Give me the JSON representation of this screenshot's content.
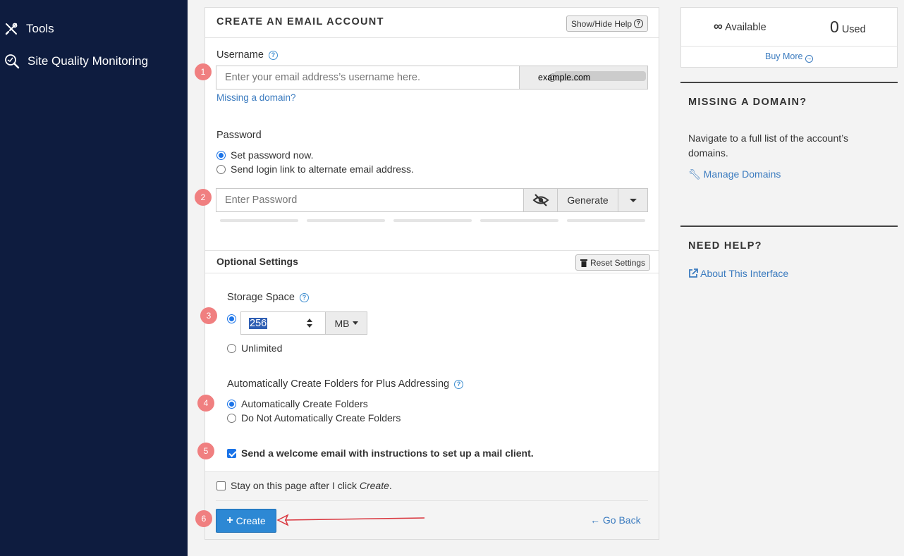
{
  "sidebar": {
    "items": [
      {
        "label": "Tools",
        "icon": "tools-icon"
      },
      {
        "label": "Site Quality Monitoring",
        "icon": "magnifier-icon"
      }
    ]
  },
  "main": {
    "title": "CREATE AN EMAIL ACCOUNT",
    "help_toggle": "Show/Hide Help",
    "username": {
      "label": "Username",
      "placeholder": "Enter your email address’s username here.",
      "at": "@",
      "domain": "example.com",
      "missing_link": "Missing a domain?"
    },
    "password": {
      "label": "Password",
      "options": [
        "Set password now.",
        "Send login link to alternate email address."
      ],
      "selected": 0,
      "placeholder": "Enter Password",
      "generate": "Generate"
    },
    "optional": {
      "title": "Optional Settings",
      "reset": "Reset Settings",
      "storage": {
        "label": "Storage Space",
        "value": "256",
        "unit": "MB",
        "unlimited": "Unlimited"
      },
      "plus": {
        "label": "Automatically Create Folders for Plus Addressing",
        "options": [
          "Automatically Create Folders",
          "Do Not Automatically Create Folders"
        ],
        "selected": 0
      },
      "welcome": "Send a welcome email with instructions to set up a mail client."
    },
    "footer": {
      "stay_prefix": "Stay on this page after I click ",
      "stay_em": "Create",
      "stay_suffix": ".",
      "create": "Create",
      "go_back": "Go Back"
    },
    "steps": [
      "1",
      "2",
      "3",
      "4",
      "5",
      "6"
    ]
  },
  "right": {
    "available_symbol": "∞",
    "available_label": "Available",
    "used_count": "0",
    "used_label": "Used",
    "buy_more": "Buy More",
    "missing_title": "MISSING A DOMAIN?",
    "missing_text": "Navigate to a full list of the account’s domains.",
    "manage_domains": "Manage Domains",
    "help_title": "NEED HELP?",
    "about": "About This Interface"
  },
  "colors": {
    "sidebar_bg": "#0e1c3f",
    "link": "#3b7bbf",
    "primary_button": "#2d88d4",
    "step_badge": "#f07f80",
    "annotation_arrow": "#d9363e"
  }
}
